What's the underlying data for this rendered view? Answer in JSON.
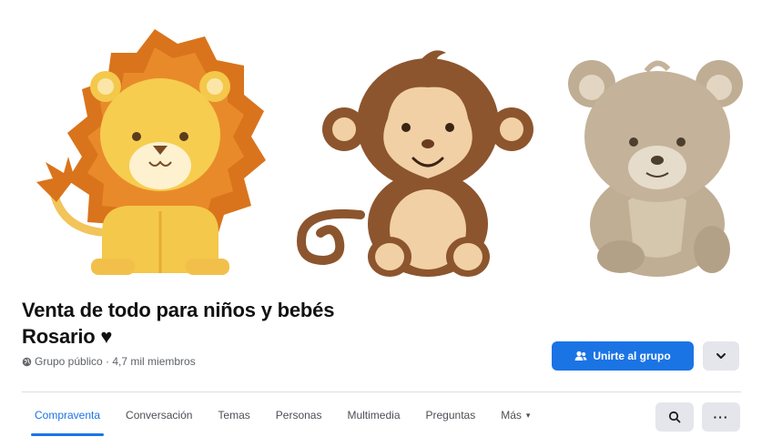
{
  "cover": {
    "animals": [
      "lion",
      "monkey",
      "bear"
    ]
  },
  "group": {
    "title": "Venta de todo para niños y bebés Rosario ",
    "heart": "♥",
    "privacy_icon": "globe-icon",
    "meta": "Grupo público · 4,7 mil miembros"
  },
  "actions": {
    "join_label": "Unirte al grupo",
    "join_icon": "people-icon",
    "join_color": "#1b74e4",
    "dropdown_icon": "chevron-down-icon"
  },
  "tabs": [
    {
      "label": "Compraventa",
      "active": true
    },
    {
      "label": "Conversación"
    },
    {
      "label": "Temas"
    },
    {
      "label": "Personas"
    },
    {
      "label": "Multimedia"
    },
    {
      "label": "Preguntas"
    },
    {
      "label": "Más",
      "caret": "▾"
    }
  ],
  "toolbar": {
    "search_icon": "search-icon",
    "overflow": "···"
  }
}
